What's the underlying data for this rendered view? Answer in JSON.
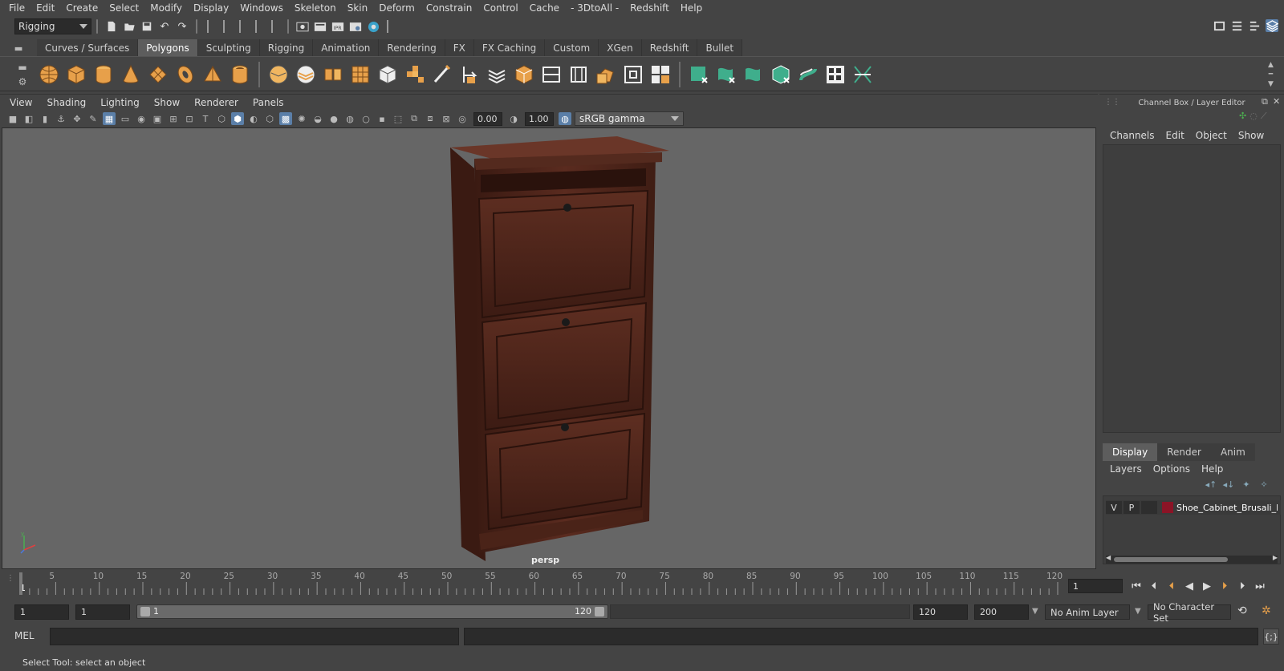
{
  "menubar": [
    "File",
    "Edit",
    "Create",
    "Select",
    "Modify",
    "Display",
    "Windows",
    "Skeleton",
    "Skin",
    "Deform",
    "Constrain",
    "Control",
    "Cache",
    "- 3DtoAll -",
    "Redshift",
    "Help"
  ],
  "statusline": {
    "mode": "Rigging"
  },
  "shelf_tabs": [
    "Curves / Surfaces",
    "Polygons",
    "Sculpting",
    "Rigging",
    "Animation",
    "Rendering",
    "FX",
    "FX Caching",
    "Custom",
    "XGen",
    "Redshift",
    "Bullet"
  ],
  "active_shelf_tab": "Polygons",
  "panel_menu": [
    "View",
    "Shading",
    "Lighting",
    "Show",
    "Renderer",
    "Panels"
  ],
  "panel_toolbar": {
    "exposure": "0.00",
    "gamma_value": "1.00",
    "color_space": "sRGB gamma"
  },
  "viewport": {
    "camera_label": "persp"
  },
  "channel_box": {
    "title": "Channel Box / Layer Editor",
    "menu": [
      "Channels",
      "Edit",
      "Object",
      "Show"
    ]
  },
  "layer_editor": {
    "tabs": [
      "Display",
      "Render",
      "Anim"
    ],
    "active_tab": "Display",
    "menu": [
      "Layers",
      "Options",
      "Help"
    ],
    "layers": [
      {
        "v": "V",
        "p": "P",
        "color": "#8b1426",
        "name": "Shoe_Cabinet_Brusali_Br"
      }
    ]
  },
  "timeline": {
    "start_label": "1",
    "ticks": [
      "5",
      "10",
      "15",
      "20",
      "25",
      "30",
      "35",
      "40",
      "45",
      "50",
      "55",
      "60",
      "65",
      "70",
      "75",
      "80",
      "85",
      "90",
      "95",
      "100",
      "105",
      "110",
      "115",
      "120"
    ],
    "current_frame": "1"
  },
  "range": {
    "start": "1",
    "playback_start": "1",
    "slider_start": "1",
    "slider_end": "120",
    "playback_end": "120",
    "end": "200",
    "anim_layer": "No Anim Layer",
    "character_set": "No Character Set"
  },
  "command_line": {
    "label": "MEL"
  },
  "help_line": "Select Tool: select an object"
}
